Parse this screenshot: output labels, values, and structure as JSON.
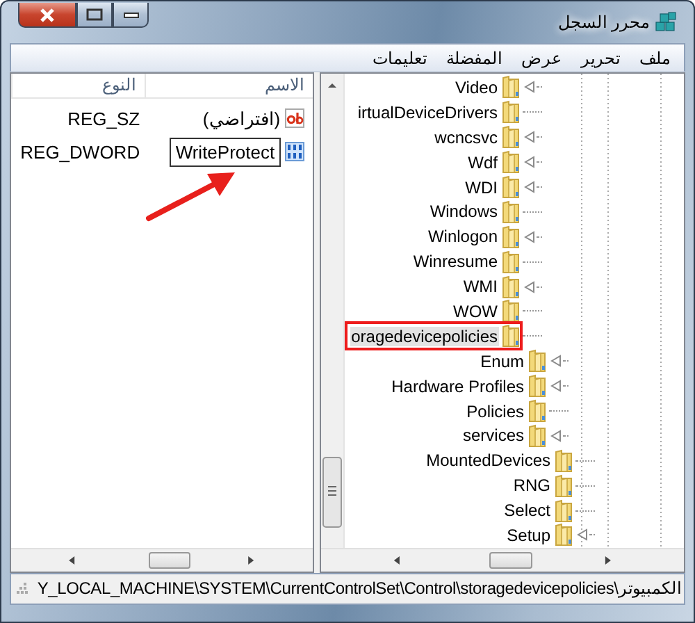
{
  "window": {
    "title": "محرر السجل",
    "controls": [
      {
        "kind": "close"
      },
      {
        "kind": "maximize"
      },
      {
        "kind": "minimize"
      }
    ]
  },
  "menu": [
    "ملف",
    "تحرير",
    "عرض",
    "المفضلة",
    "تعليمات"
  ],
  "values_list": {
    "columns": [
      "الاسم",
      "النوع"
    ],
    "rows": [
      {
        "kind": "string",
        "name": "(افتراضي)",
        "type": "REG_SZ",
        "editing": false
      },
      {
        "kind": "binary",
        "name": "WriteProtect",
        "type": "REG_DWORD",
        "editing": true
      }
    ],
    "annotations": [
      {
        "kind": "arrow"
      }
    ]
  },
  "tree": {
    "children": [
      {
        "children": [
          {
            "children": [
              {
                "label": "Video",
                "expandable": true,
                "selected": false,
                "highlighted": false
              },
              {
                "label": "irtualDeviceDrivers",
                "expandable": false,
                "selected": false,
                "highlighted": false
              },
              {
                "label": "wcncsvc",
                "expandable": true,
                "selected": false,
                "highlighted": false
              },
              {
                "label": "Wdf",
                "expandable": true,
                "selected": false,
                "highlighted": false
              },
              {
                "label": "WDI",
                "expandable": true,
                "selected": false,
                "highlighted": false
              },
              {
                "label": "Windows",
                "expandable": false,
                "selected": false,
                "highlighted": false
              },
              {
                "label": "Winlogon",
                "expandable": true,
                "selected": false,
                "highlighted": false
              },
              {
                "label": "Winresume",
                "expandable": false,
                "selected": false,
                "highlighted": false
              },
              {
                "label": "WMI",
                "expandable": true,
                "selected": false,
                "highlighted": false
              },
              {
                "label": "WOW",
                "expandable": false,
                "selected": false,
                "highlighted": false
              },
              {
                "label": "oragedevicepolicies",
                "expandable": false,
                "selected": true,
                "highlighted": true
              }
            ]
          },
          {
            "label": "Enum",
            "expandable": true,
            "selected": false,
            "highlighted": false
          },
          {
            "label": "Hardware Profiles",
            "expandable": true,
            "selected": false,
            "highlighted": false
          },
          {
            "label": "Policies",
            "expandable": false,
            "selected": false,
            "highlighted": false
          },
          {
            "label": "services",
            "expandable": true,
            "selected": false,
            "highlighted": false
          }
        ]
      },
      {
        "label": "MountedDevices",
        "expandable": false,
        "selected": false,
        "highlighted": false
      },
      {
        "label": "RNG",
        "expandable": false,
        "selected": false,
        "highlighted": false
      },
      {
        "label": "Select",
        "expandable": false,
        "selected": false,
        "highlighted": false
      },
      {
        "label": "Setup",
        "expandable": true,
        "selected": false,
        "highlighted": false
      }
    ]
  },
  "status_bar": "الكمبيوتر\\Y_LOCAL_MACHINE\\SYSTEM\\CurrentControlSet\\Control\\storagedevicepolicies"
}
